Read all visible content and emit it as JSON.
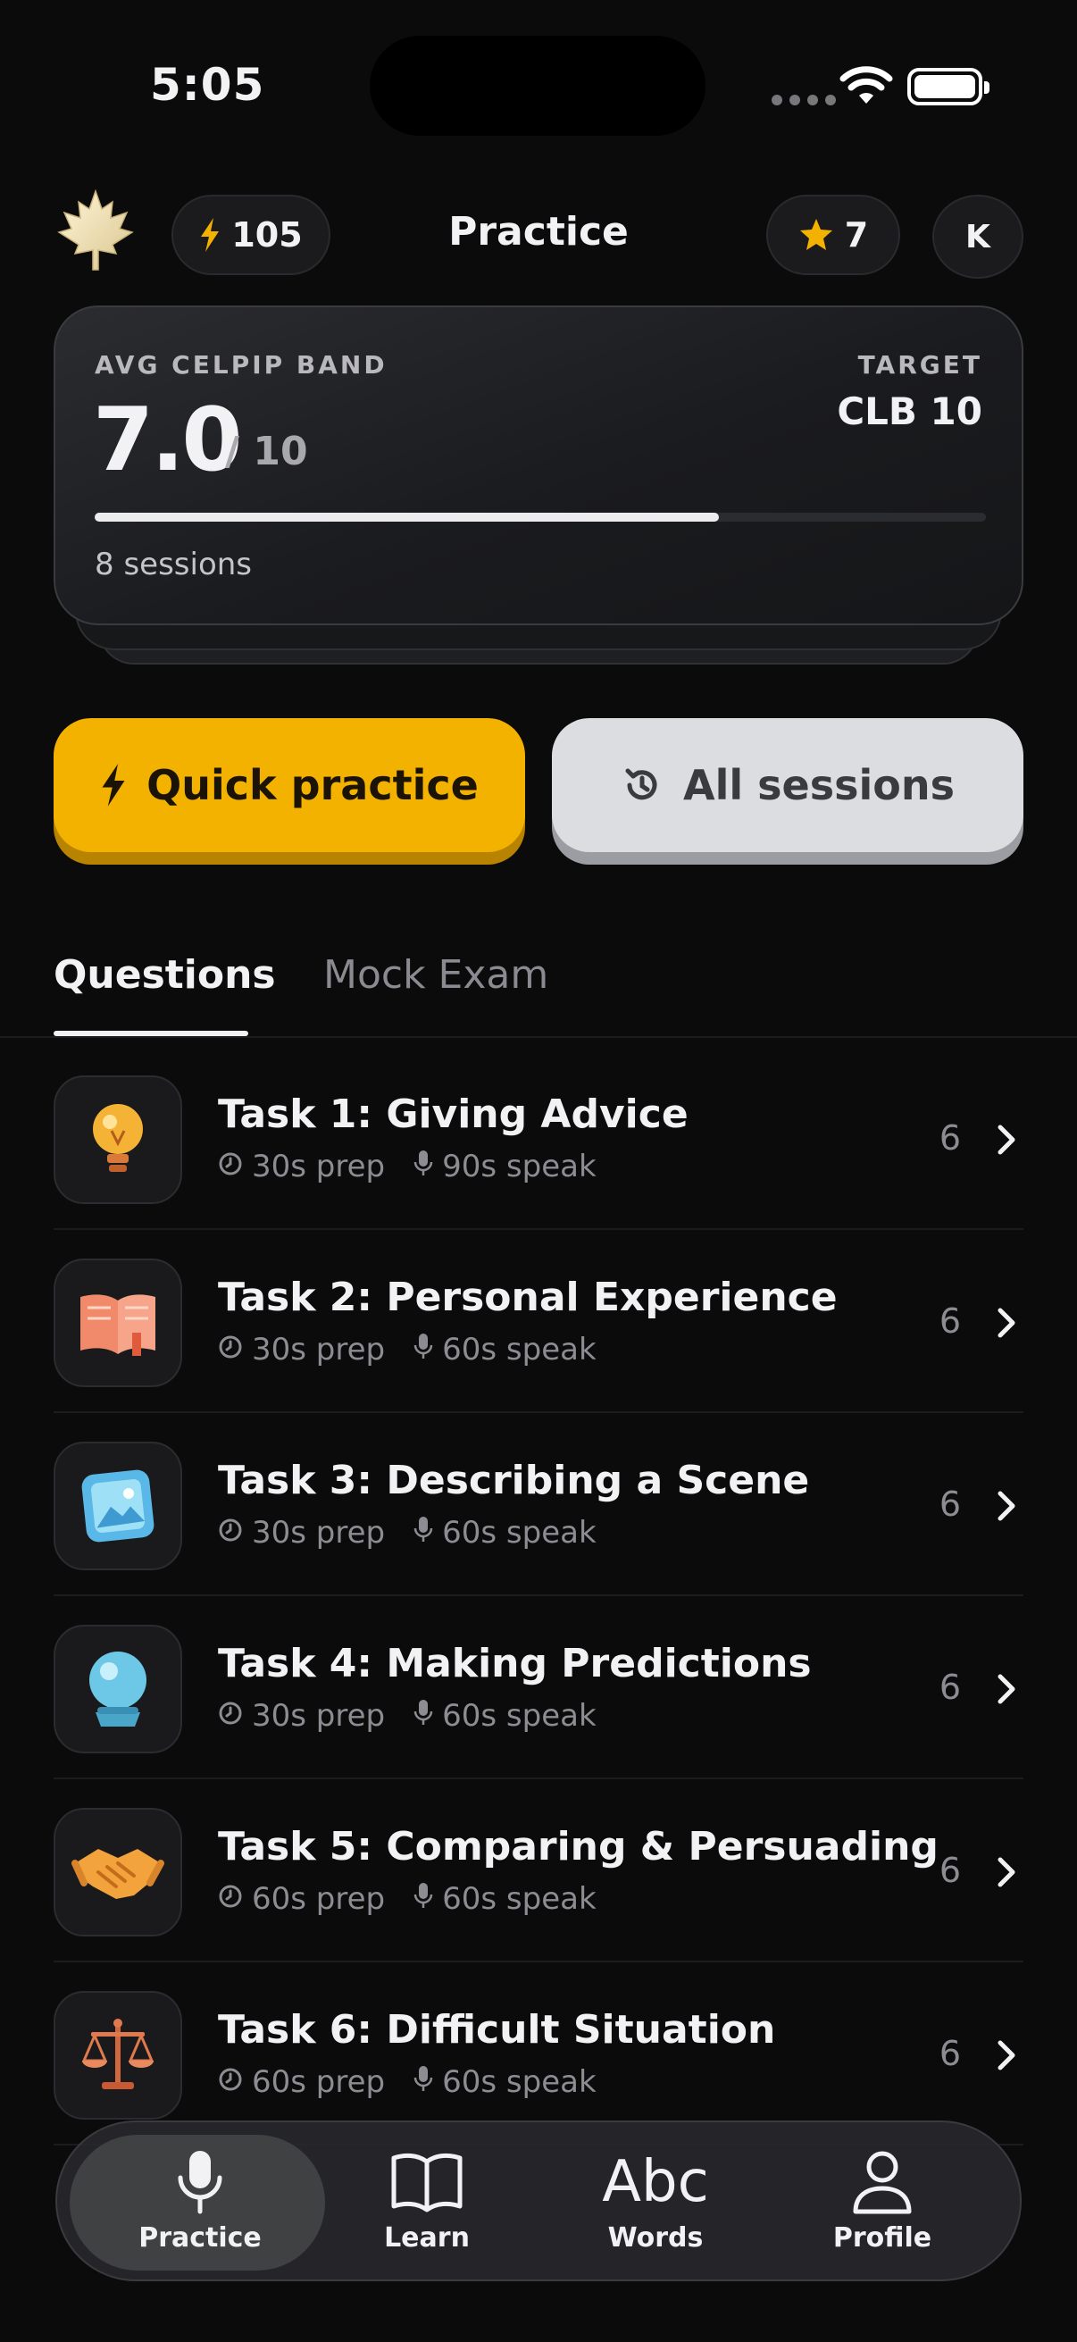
{
  "status_bar": {
    "time": "5:05"
  },
  "header": {
    "title": "Practice",
    "streak": "105",
    "stars": "7",
    "avatar_initial": "K"
  },
  "band_card": {
    "label": "AVG CELPIP BAND",
    "value": "7.0",
    "max": "/ 10",
    "target_label": "TARGET",
    "target_value": "CLB 10",
    "progress": 0.7,
    "sessions": "8 sessions"
  },
  "actions": {
    "quick_label": "Quick practice",
    "all_label": "All sessions"
  },
  "tabs": {
    "questions": "Questions",
    "mock": "Mock Exam",
    "active": "questions"
  },
  "tasks": [
    {
      "title": "Task 1: Giving Advice",
      "prep": "30s prep",
      "speak": "90s speak",
      "count": "6",
      "icon": "lightbulb-icon"
    },
    {
      "title": "Task 2: Personal Experience",
      "prep": "30s prep",
      "speak": "60s speak",
      "count": "6",
      "icon": "book-icon"
    },
    {
      "title": "Task 3: Describing a Scene",
      "prep": "30s prep",
      "speak": "60s speak",
      "count": "6",
      "icon": "picture-icon"
    },
    {
      "title": "Task 4: Making Predictions",
      "prep": "30s prep",
      "speak": "60s speak",
      "count": "6",
      "icon": "crystal-ball-icon"
    },
    {
      "title": "Task 5: Comparing & Persuading",
      "prep": "60s prep",
      "speak": "60s speak",
      "count": "6",
      "icon": "handshake-icon"
    },
    {
      "title": "Task 6: Difficult Situation",
      "prep": "60s prep",
      "speak": "60s speak",
      "count": "6",
      "icon": "scales-icon"
    }
  ],
  "tabbar": {
    "practice": "Practice",
    "learn": "Learn",
    "words_glyph": "Abc",
    "words": "Words",
    "profile": "Profile",
    "active": "practice"
  },
  "colors": {
    "accent": "#f4b200",
    "background": "#0b0b0c"
  }
}
